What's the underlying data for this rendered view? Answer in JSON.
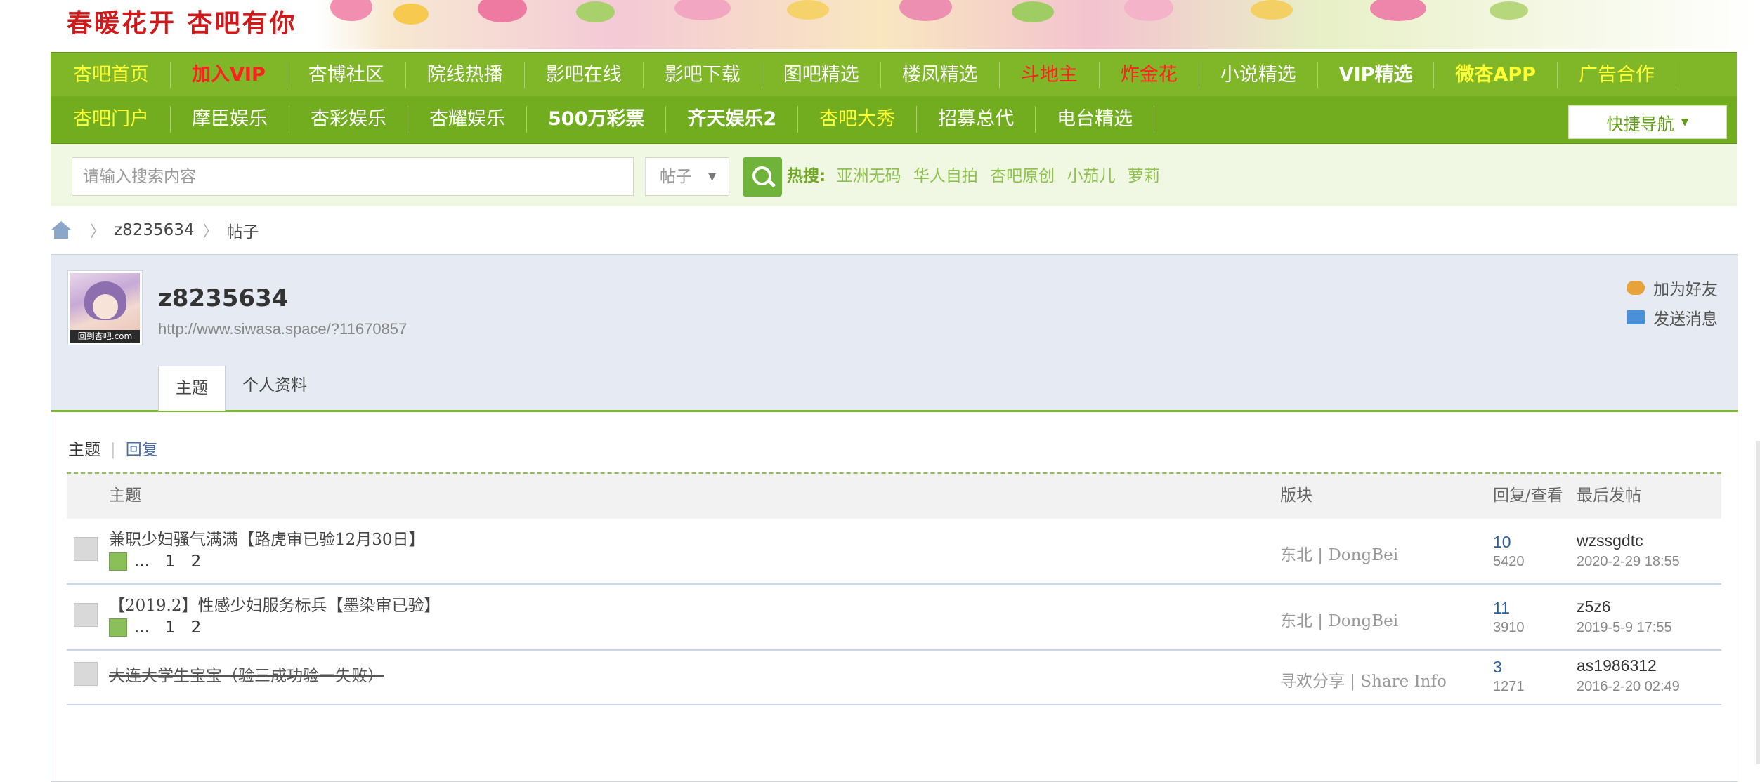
{
  "banner": {
    "slogan": "春暖花开 杏吧有你"
  },
  "nav_row1": [
    {
      "label": "杏吧首页",
      "color": "yellow"
    },
    {
      "label": "加入VIP",
      "color": "red"
    },
    {
      "label": "杏博社区",
      "color": "white"
    },
    {
      "label": "院线热播",
      "color": "white"
    },
    {
      "label": "影吧在线",
      "color": "white"
    },
    {
      "label": "影吧下载",
      "color": "white"
    },
    {
      "label": "图吧精选",
      "color": "white"
    },
    {
      "label": "楼凤精选",
      "color": "white"
    },
    {
      "label": "斗地主",
      "color": "red"
    },
    {
      "label": "炸金花",
      "color": "red"
    },
    {
      "label": "小说精选",
      "color": "white"
    },
    {
      "label": "VIP精选",
      "color": "white"
    },
    {
      "label": "微杏APP",
      "color": "yellow"
    },
    {
      "label": "广告合作",
      "color": "yellow"
    }
  ],
  "nav_row2": [
    {
      "label": "杏吧门户",
      "color": "yellow"
    },
    {
      "label": "摩臣娱乐",
      "color": "white"
    },
    {
      "label": "杏彩娱乐",
      "color": "white"
    },
    {
      "label": "杏耀娱乐",
      "color": "white"
    },
    {
      "label": "500万彩票",
      "color": "white"
    },
    {
      "label": "齐天娱乐2",
      "color": "white"
    },
    {
      "label": "杏吧大秀",
      "color": "yellow"
    },
    {
      "label": "招募总代",
      "color": "white"
    },
    {
      "label": "电台精选",
      "color": "white"
    }
  ],
  "quick_nav": {
    "label": "快捷导航"
  },
  "search": {
    "placeholder": "请输入搜索内容",
    "type": "帖子",
    "hot_label": "热搜:",
    "hot_keywords": [
      "亚洲无码",
      "华人自拍",
      "杏吧原创",
      "小茄儿",
      "萝莉"
    ]
  },
  "breadcrumb": {
    "user": "z8235634",
    "page": "帖子"
  },
  "profile": {
    "avatar_tag": "回到杏吧.com",
    "username": "z8235634",
    "url": "http://www.siwasa.space/?11670857",
    "add_friend": "加为好友",
    "send_message": "发送消息",
    "tabs": [
      "主题",
      "个人资料"
    ]
  },
  "subtabs": {
    "active": "主题",
    "other": "回复"
  },
  "table": {
    "headers": {
      "topic": "主题",
      "forum": "版块",
      "replies_views": "回复/查看",
      "last_post": "最后发帖"
    },
    "rows": [
      {
        "title": "兼职少妇骚气满满【路虎审已验12月30日】",
        "pages": [
          "...",
          "1",
          "2"
        ],
        "forum": "东北 | DongBei",
        "replies": "10",
        "views": "5420",
        "last_user": "wzssgdtc",
        "last_time": "2020-2-29 18:55",
        "strike": false
      },
      {
        "title": "【2019.2】性感少妇服务标兵【墨染审已验】",
        "pages": [
          "...",
          "1",
          "2"
        ],
        "forum": "东北 | DongBei",
        "replies": "11",
        "views": "3910",
        "last_user": "z5z6",
        "last_time": "2019-5-9 17:55",
        "strike": false
      },
      {
        "title": "大连大学生宝宝（验三成功验一失败）",
        "pages": [],
        "forum": "寻欢分享 | Share Info",
        "replies": "3",
        "views": "1271",
        "last_user": "as1986312",
        "last_time": "2016-2-20 02:49",
        "strike": true
      }
    ]
  },
  "colors": {
    "nav_green": "#7fb728",
    "nav_green_dark": "#71ad1f",
    "accent_yellow": "#ffff33",
    "accent_red": "#ff2020",
    "link_blue": "#2b5d9c"
  }
}
